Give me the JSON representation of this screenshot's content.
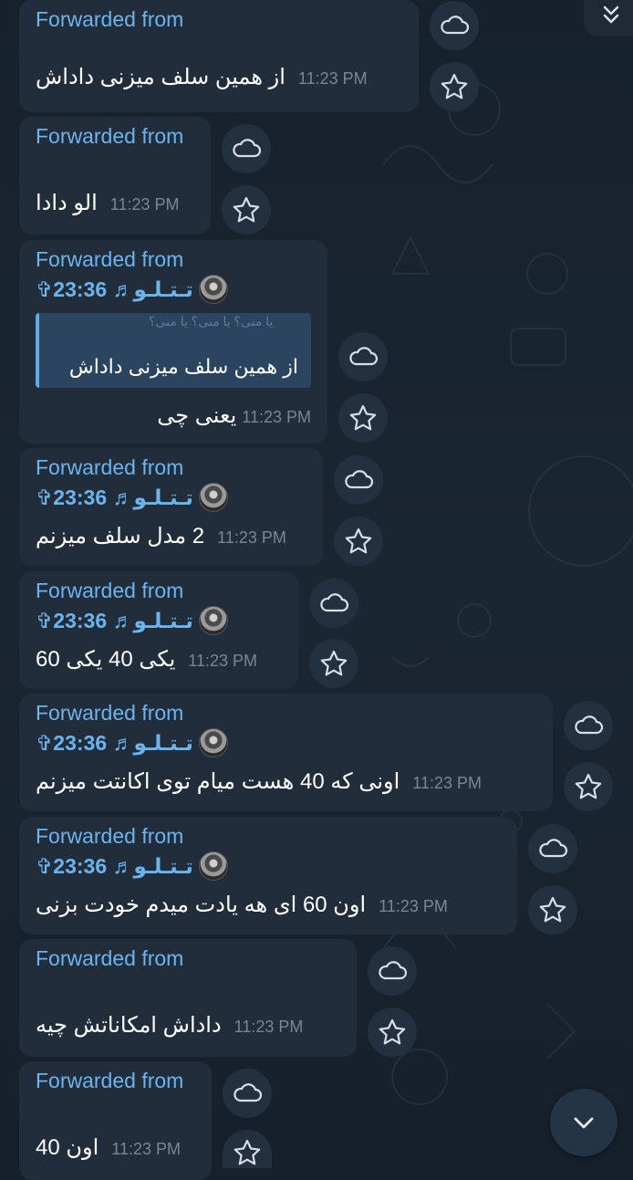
{
  "forwarded_label": "Forwarded from",
  "messages": [
    {
      "text": "از همین سلف میزنی داداش",
      "time": "11:23 PM"
    },
    {
      "text": "الو دادا",
      "time": "11:23 PM"
    },
    {
      "author": "✞تـتـلـو♬ 23:36",
      "quote_decoration": "یا منی؟ یا منی؟ یا منی؟",
      "quote": "از همین سلف میزنی داداش",
      "text": "یعنی چی",
      "time": "11:23 PM"
    },
    {
      "author": "✞تـتـلـو♬ 23:36",
      "text": "2 مدل سلف میزنم",
      "time": "11:23 PM"
    },
    {
      "author": "✞تـتـلـو♬ 23:36",
      "text": "یکی 40 یکی 60",
      "time": "11:23 PM"
    },
    {
      "author": "✞تـتـلـو♬ 23:36",
      "text": "اونی که 40 هست میام توی اکانتت میزنم",
      "time": "11:23 PM"
    },
    {
      "author": "✞تـتـلـو♬ 23:36",
      "text": "اون 60 ای هه یادت میدم خودت بزنی",
      "time": "11:23 PM"
    },
    {
      "text": "داداش امکاناتش چیه",
      "time": "11:23 PM"
    },
    {
      "text": "اون 40",
      "time": "11:23 PM"
    }
  ],
  "icons": {
    "save": "cloud-icon",
    "favorite": "star-icon",
    "scroll_up": "double-chevron-up-icon",
    "scroll_down": "chevron-down-icon"
  },
  "colors": {
    "background": "#17222d",
    "bubble": "#212d3b",
    "link": "#6cb4ee",
    "time": "#75879a",
    "quote_bg": "#2b4460",
    "quote_bar": "#5ea9e8"
  }
}
